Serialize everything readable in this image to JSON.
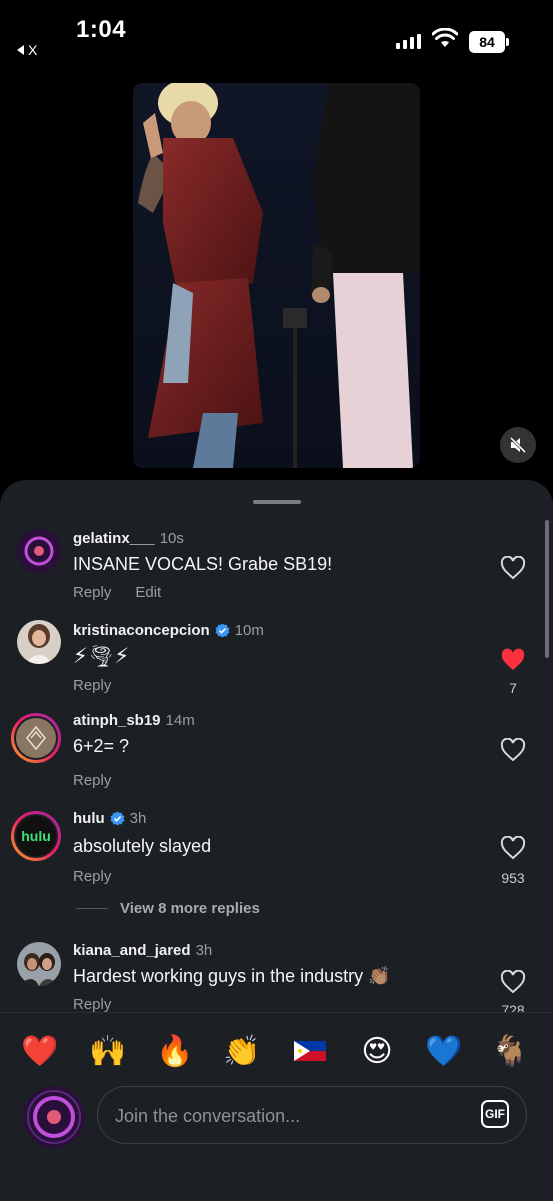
{
  "status": {
    "time": "1:04",
    "back_app": "X",
    "battery": "84"
  },
  "comments": [
    {
      "username": "gelatinx___",
      "ago": "10s",
      "text": "INSANE VOCALS! Grabe SB19!",
      "reply": "Reply",
      "edit": "Edit",
      "liked": false,
      "likes": ""
    },
    {
      "username": "kristinaconcepcion",
      "verified": true,
      "ago": "10m",
      "text": "⚡🌪⚡",
      "reply": "Reply",
      "liked": true,
      "likes": "7"
    },
    {
      "username": "atinph_sb19",
      "ago": "14m",
      "text": "6+2= ?",
      "reply": "Reply",
      "liked": false,
      "likes": ""
    },
    {
      "username": "hulu",
      "verified": true,
      "ago": "3h",
      "text": "absolutely slayed",
      "reply": "Reply",
      "liked": false,
      "likes": "953",
      "avatar_text": "hulu",
      "view_more": "View 8 more replies"
    },
    {
      "username": "kiana_and_jared",
      "ago": "3h",
      "text": "Hardest working guys in the industry 👏🏽",
      "reply": "Reply",
      "liked": false,
      "likes": "728"
    }
  ],
  "quick_emojis": [
    "❤️",
    "🙌",
    "🔥",
    "👏",
    "🇵🇭",
    "😍",
    "💙",
    "🐐"
  ],
  "composer": {
    "placeholder": "Join the conversation...",
    "gif_label": "GIF"
  },
  "colors": {
    "sheet_bg": "#1c1f23",
    "liked_heart": "#ff3040",
    "verified": "#3897f0"
  }
}
